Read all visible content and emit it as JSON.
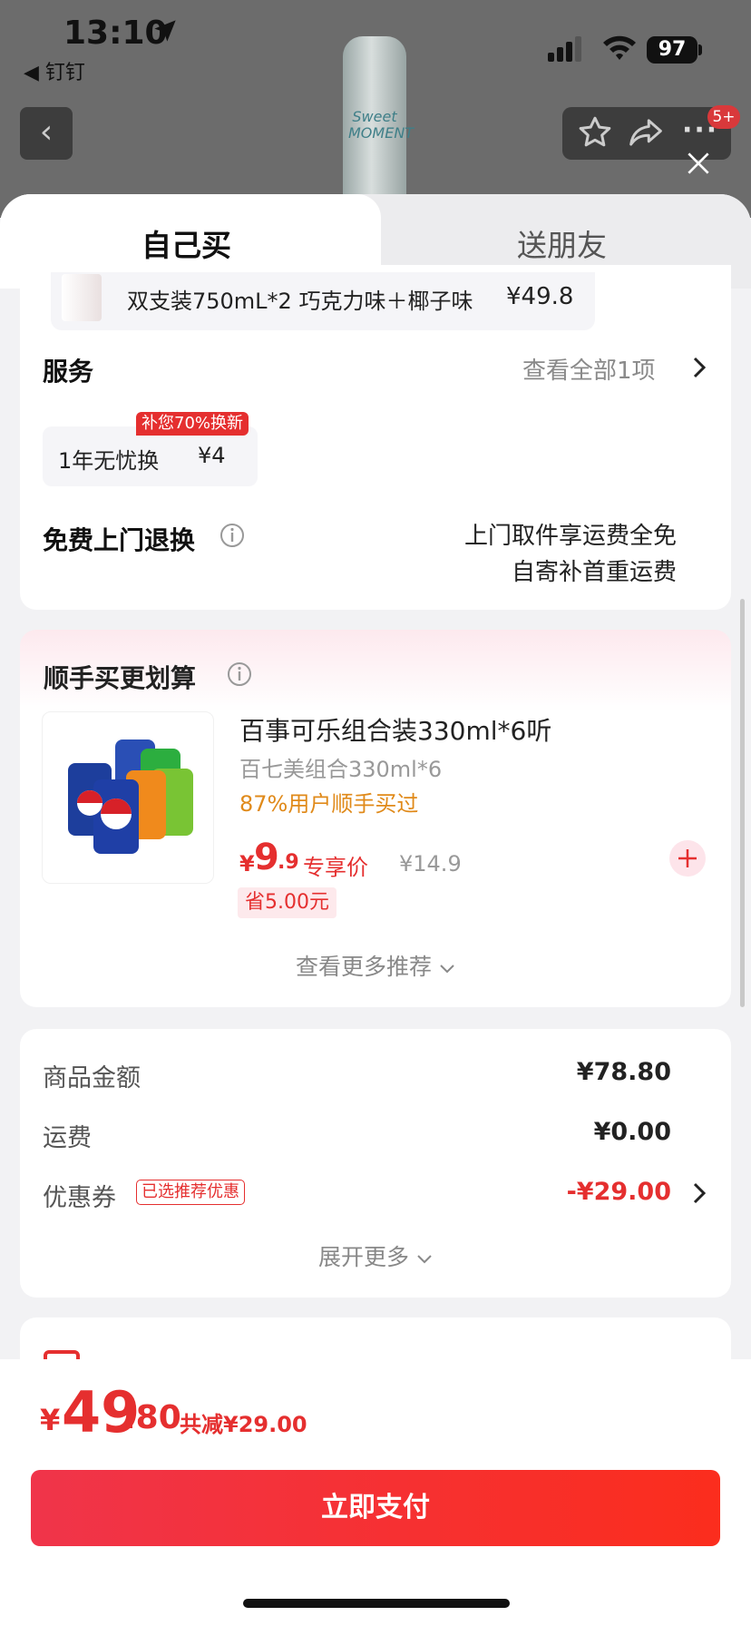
{
  "status_bar": {
    "time": "13:10",
    "back_app": "◀ 钉钉",
    "battery": "97"
  },
  "background_page": {
    "bottle_label": "Sweet MOMENT",
    "badge": "5+"
  },
  "tabs": [
    {
      "label": "自己买"
    },
    {
      "label": "送朋友"
    }
  ],
  "variant": {
    "text": "双支装750mL*2 巧克力味＋椰子味",
    "price": "¥49.8"
  },
  "service": {
    "title": "服务",
    "view_all": "查看全部1项",
    "item_name": "1年无忧换",
    "item_price": "¥4",
    "item_tag": "补您70%换新"
  },
  "free_return": {
    "title": "免费上门退换",
    "line1": "上门取件享运费全免",
    "line2": "自寄补首重运费"
  },
  "recommend": {
    "title": "顺手买更划算",
    "product_name": "百事可乐组合装330ml*6听",
    "product_sub": "百七美组合330ml*6",
    "buy_pct": "87%用户顺手买过",
    "price_yen": "¥",
    "price_int": "9",
    "price_dec": ".9",
    "price_label": "专享价",
    "price_orig": "¥14.9",
    "save_tag": "省5.00元",
    "more": "查看更多推荐"
  },
  "summary": {
    "goods_label": "商品金额",
    "goods_value": "¥78.80",
    "shipping_label": "运费",
    "shipping_value": "¥0.00",
    "coupon_label": "优惠券",
    "coupon_tag": "已选推荐优惠",
    "coupon_value": "-¥29.00",
    "expand": "展开更多"
  },
  "bottom": {
    "total_yen": "¥",
    "total_int": "49",
    "total_dec": ".80",
    "total_save": "共减¥29.00",
    "pay_label": "立即支付"
  },
  "colors": {
    "accent": "#e52f2f",
    "pay_gradient_start": "#f0344a",
    "pay_gradient_end": "#fb2d1d"
  }
}
